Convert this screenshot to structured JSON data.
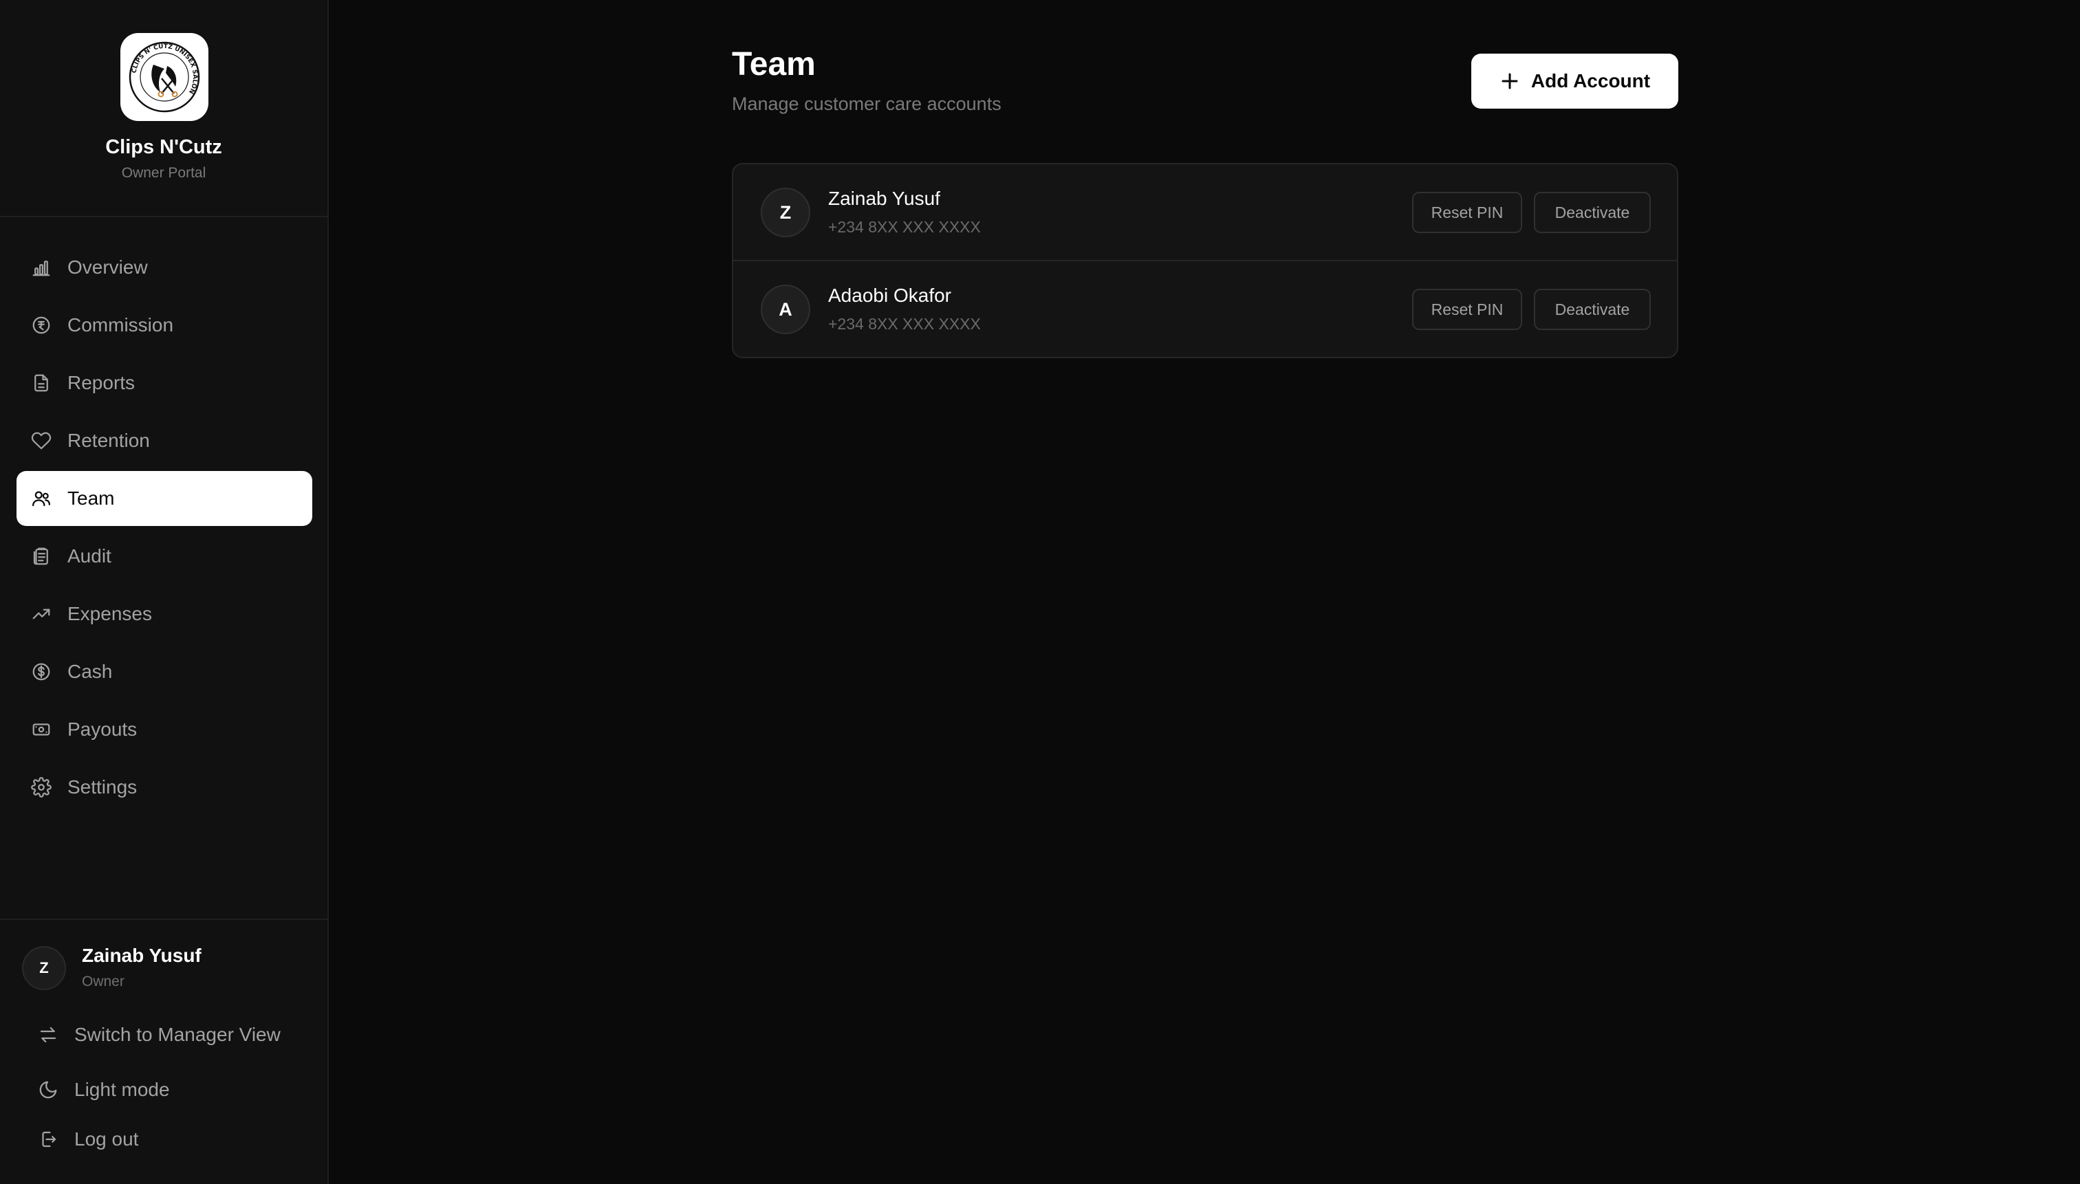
{
  "brand": {
    "name": "Clips N'Cutz",
    "subtitle": "Owner Portal",
    "logo_text": "CLIPS N' CUTZ UNISEX SALON"
  },
  "sidebar": {
    "items": [
      {
        "label": "Overview",
        "icon": "bar-chart-icon",
        "active": false
      },
      {
        "label": "Commission",
        "icon": "coin-icon",
        "active": false
      },
      {
        "label": "Reports",
        "icon": "document-icon",
        "active": false
      },
      {
        "label": "Retention",
        "icon": "heart-icon",
        "active": false
      },
      {
        "label": "Team",
        "icon": "users-icon",
        "active": true
      },
      {
        "label": "Audit",
        "icon": "clipboard-icon",
        "active": false
      },
      {
        "label": "Expenses",
        "icon": "trending-up-icon",
        "active": false
      },
      {
        "label": "Cash",
        "icon": "dollar-circle-icon",
        "active": false
      },
      {
        "label": "Payouts",
        "icon": "banknote-icon",
        "active": false
      },
      {
        "label": "Settings",
        "icon": "gear-icon",
        "active": false
      }
    ]
  },
  "user": {
    "initial": "Z",
    "name": "Zainab Yusuf",
    "role": "Owner"
  },
  "footer_links": {
    "switch_view": "Switch to Manager View",
    "theme": "Light mode",
    "logout": "Log out"
  },
  "main": {
    "title": "Team",
    "subtitle": "Manage customer care accounts",
    "add_button": "Add Account",
    "accounts": [
      {
        "initial": "Z",
        "name": "Zainab Yusuf",
        "phone": "+234 8XX XXX XXXX",
        "reset_label": "Reset PIN",
        "deactivate_label": "Deactivate"
      },
      {
        "initial": "A",
        "name": "Adaobi Okafor",
        "phone": "+234 8XX XXX XXXX",
        "reset_label": "Reset PIN",
        "deactivate_label": "Deactivate"
      }
    ]
  },
  "colors": {
    "background": "#0a0a0a",
    "sidebar": "#111111",
    "active_nav": "#ffffff",
    "muted_text": "#a3a3a3"
  }
}
